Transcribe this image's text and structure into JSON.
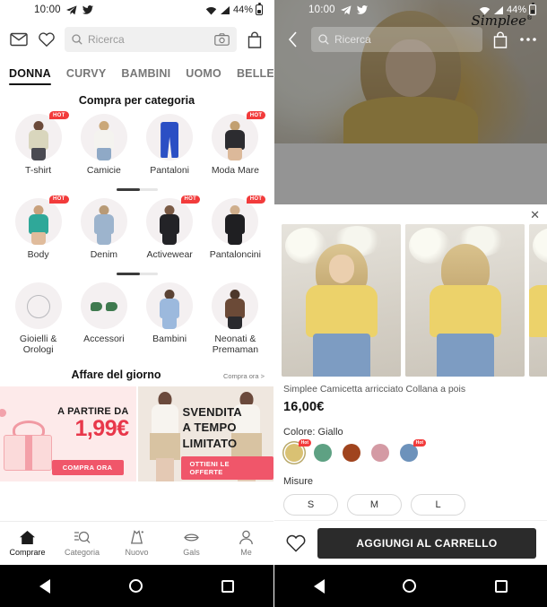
{
  "left": {
    "status": {
      "time": "10:00",
      "battery_pct": "44%",
      "icons": [
        "telegram-icon",
        "twitter-icon",
        "wifi-icon",
        "signal-icon",
        "battery-icon"
      ]
    },
    "topbar": {
      "mail_icon": "mail-icon",
      "wishlist_icon": "heart-icon",
      "search_placeholder": "Ricerca",
      "camera_icon": "camera-icon",
      "bag_icon": "shopping-bag-icon"
    },
    "tabs": [
      {
        "label": "DONNA",
        "active": true
      },
      {
        "label": "CURVY",
        "active": false
      },
      {
        "label": "BAMBINI",
        "active": false
      },
      {
        "label": "UOMO",
        "active": false
      },
      {
        "label": "BELLE",
        "active": false
      }
    ],
    "category_section": {
      "title": "Compra per categoria",
      "rows": [
        [
          {
            "label": "T-shirt",
            "hot": "HOT"
          },
          {
            "label": "Camicie",
            "hot": ""
          },
          {
            "label": "Pantaloni",
            "hot": ""
          },
          {
            "label": "Moda Mare",
            "hot": "HOT"
          }
        ],
        [
          {
            "label": "Body",
            "hot": "HOT"
          },
          {
            "label": "Denim",
            "hot": ""
          },
          {
            "label": "Activewear",
            "hot": "HOT"
          },
          {
            "label": "Pantaloncini",
            "hot": "HOT"
          }
        ],
        [
          {
            "label": "Gioielli & Orologi",
            "hot": ""
          },
          {
            "label": "Accessori",
            "hot": ""
          },
          {
            "label": "Bambini",
            "hot": ""
          },
          {
            "label": "Neonati & Premaman",
            "hot": ""
          }
        ]
      ]
    },
    "deal_section": {
      "title": "Affare del giorno",
      "more_label": "Compra ora >",
      "left_banner": {
        "from_label": "A PARTIRE DA",
        "price": "1,99€",
        "button": "COMPRA ORA"
      },
      "right_banner": {
        "line1": "SVENDITA",
        "line2": "A TEMPO",
        "line3": "LIMITATO",
        "button": "OTTIENI LE OFFERTE"
      }
    },
    "bottom_nav": [
      {
        "label": "Comprare",
        "icon": "home-icon",
        "active": true
      },
      {
        "label": "Categoria",
        "icon": "category-search-icon",
        "active": false
      },
      {
        "label": "Nuovo",
        "icon": "dress-sparkle-icon",
        "active": false
      },
      {
        "label": "Gals",
        "icon": "lips-icon",
        "active": false
      },
      {
        "label": "Me",
        "icon": "person-icon",
        "active": false
      }
    ]
  },
  "right": {
    "status": {
      "time": "10:00",
      "battery_pct": "44%"
    },
    "topbar": {
      "back_icon": "chevron-left-icon",
      "search_placeholder": "Ricerca",
      "bag_icon": "shopping-bag-icon",
      "more_icon": "more-horizontal-icon"
    },
    "hero": {
      "brand": "Simplee",
      "brand_sup": "®"
    },
    "sheet": {
      "close_label": "✕",
      "product_title": "Simplee Camicetta arricciato Collana a pois",
      "price": "16,00€",
      "color_label": "Colore: Giallo",
      "colors": [
        {
          "name": "Giallo",
          "hex": "#d9c173",
          "selected": true,
          "hot": "Hot"
        },
        {
          "name": "Verde",
          "hex": "#5ea183",
          "selected": false,
          "hot": ""
        },
        {
          "name": "Marrone",
          "hex": "#a0441e",
          "selected": false,
          "hot": ""
        },
        {
          "name": "Rosa",
          "hex": "#d49aa4",
          "selected": false,
          "hot": ""
        },
        {
          "name": "Blu",
          "hex": "#6d92bb",
          "selected": false,
          "hot": "Hot"
        }
      ],
      "size_label": "Misure",
      "sizes": [
        "S",
        "M",
        "L"
      ],
      "wishlist_icon": "heart-icon",
      "add_to_cart": "AGGIUNGI AL CARRELLO"
    }
  },
  "system_nav": {
    "back": "back-triangle-icon",
    "home": "home-circle-icon",
    "recents": "recents-square-icon"
  },
  "colors": {
    "accent_red": "#f23b3b",
    "price_red": "#e8374a",
    "dark": "#2b2b2b",
    "pink_bg": "#fdeaea"
  }
}
